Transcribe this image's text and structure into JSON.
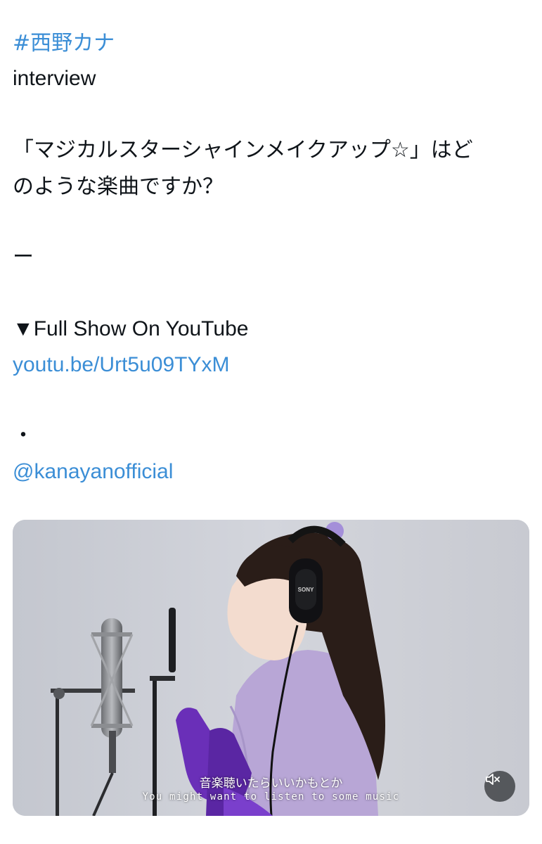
{
  "tweet": {
    "hashtag": "#西野カナ",
    "line_interview": "interview",
    "question_line1": "「マジカルスターシャインメイクアップ☆」はど",
    "question_line2": "のような楽曲ですか？",
    "dash": "ー",
    "full_show": "▼Full Show On YouTube",
    "youtube_link": "youtu.be/Urt5u09TYxM",
    "dot": "・",
    "mention": "@kanayanofficial"
  },
  "video": {
    "subtitle_jp": "音楽聴いたらいいかもとか",
    "subtitle_en": "You might want to listen to some music",
    "headphone_brand": "SONY",
    "mute_icon": "speaker-muted-icon",
    "colors": {
      "background": "#c9ccd4",
      "outfit": "#b8a6d6",
      "gloves": "#6a2fb8"
    }
  },
  "colors": {
    "link": "#3b8ed6",
    "text": "#0f1419"
  }
}
